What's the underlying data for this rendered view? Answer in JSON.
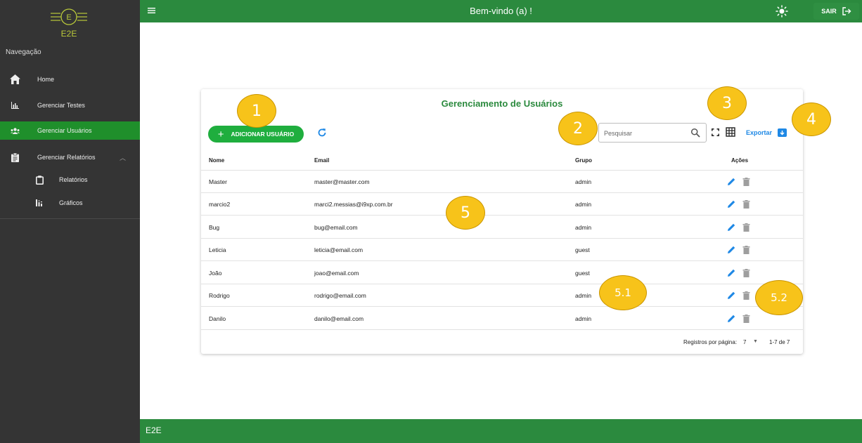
{
  "sidebar": {
    "logo_text": "E2E",
    "logo_letter": "E",
    "nav_title": "Navegação",
    "items": [
      {
        "label": "Home",
        "icon": "home-icon"
      },
      {
        "label": "Gerenciar Testes",
        "icon": "chart-icon"
      },
      {
        "label": "Gerenciar Usuários",
        "icon": "users-icon",
        "active": true
      },
      {
        "label": "Gerenciar Relatórios",
        "icon": "clipboard-icon",
        "expanded": true
      },
      {
        "label": "Relatórios",
        "icon": "clipboard-outline-icon"
      },
      {
        "label": "Gráficos",
        "icon": "bar-chart-icon"
      }
    ]
  },
  "header": {
    "welcome": "Bem-vindo (a) !",
    "logout_label": "SAIR"
  },
  "footer": {
    "label": "E2E"
  },
  "card": {
    "title": "Gerenciamento de Usuários",
    "add_button": "ADICIONAR USUÁRIO",
    "search_placeholder": "Pesquisar",
    "export_label": "Exportar",
    "columns": [
      "Nome",
      "Email",
      "Grupo",
      "Ações"
    ],
    "rows": [
      {
        "nome": "Master",
        "email": "master@master.com",
        "grupo": "admin"
      },
      {
        "nome": "marcio2",
        "email": "marci2.messias@i9xp.com.br",
        "grupo": "admin"
      },
      {
        "nome": "Bug",
        "email": "bug@email.com",
        "grupo": "admin"
      },
      {
        "nome": "Leticia",
        "email": "leticia@email.com",
        "grupo": "guest"
      },
      {
        "nome": "João",
        "email": "joao@email.com",
        "grupo": "guest"
      },
      {
        "nome": "Rodrigo",
        "email": "rodrigo@email.com",
        "grupo": "admin"
      },
      {
        "nome": "Danilo",
        "email": "danilo@email.com",
        "grupo": "admin"
      }
    ],
    "pagination": {
      "label": "Registros por página:",
      "per_page": "7",
      "range": "1-7 de 7"
    }
  },
  "markers": [
    "1",
    "2",
    "3",
    "4",
    "5",
    "5.1",
    "5.2"
  ],
  "colors": {
    "primary_green": "#2b8a3e",
    "button_green": "#1fae3e",
    "sidebar_bg": "#343434",
    "active_item": "#1f8f2b",
    "link_blue": "#1e88e5",
    "marker_yellow": "#f7c31a",
    "logo_color": "#b9c93a"
  }
}
